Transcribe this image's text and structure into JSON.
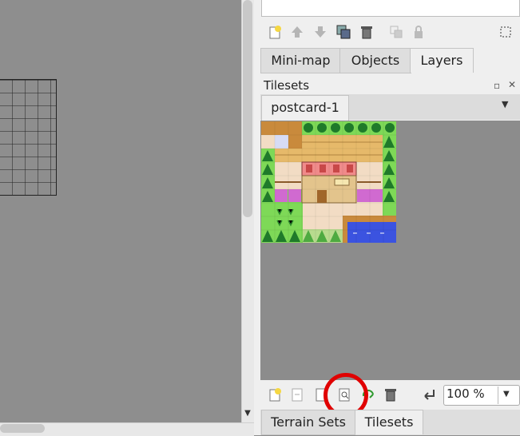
{
  "map_view": {
    "scroll_down_glyph": "▼"
  },
  "layers_toolbar": {
    "icons": [
      "new-layer-icon",
      "raise-layer-icon",
      "lower-layer-icon",
      "duplicate-layer-icon",
      "delete-layer-icon",
      "merge-layer-icon",
      "lock-layer-icon",
      "layer-settings-icon"
    ]
  },
  "top_tabs": [
    {
      "label": "Mini-map",
      "active": false
    },
    {
      "label": "Objects",
      "active": false
    },
    {
      "label": "Layers",
      "active": true
    }
  ],
  "tilesets_panel": {
    "title": "Tilesets",
    "float_glyph": "▫",
    "close_glyph": "✕",
    "tab_label": "postcard-1",
    "dropdown_glyph": "▼"
  },
  "tileset_toolbar": {
    "icons": [
      "new-tileset-icon",
      "import-tileset-icon",
      "export-tileset-icon",
      "tileset-properties-icon",
      "replace-tileset-icon",
      "remove-tileset-icon",
      "dynamic-wrap-icon"
    ],
    "zoom_value": "100 %",
    "zoom_arrow": "▼"
  },
  "bottom_tabs": [
    {
      "label": "Terrain Sets",
      "active": false
    },
    {
      "label": "Tilesets",
      "active": true
    }
  ],
  "colors": {
    "highlight_circle": "#e00000",
    "panel_bg": "#efefef",
    "canvas_bg": "#8e8e8e"
  }
}
